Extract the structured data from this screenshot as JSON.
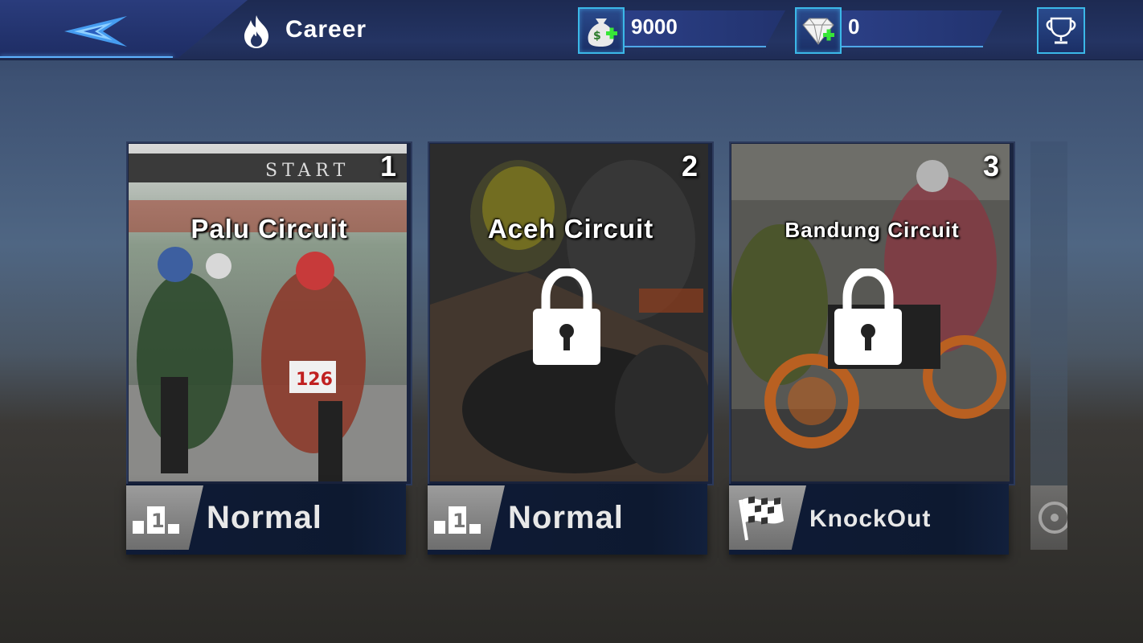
{
  "header": {
    "title": "Career",
    "money": "9000",
    "gems": "0"
  },
  "icons": {
    "back": "back-arrow-icon",
    "title": "flame-icon",
    "money": "money-bag-icon",
    "gems": "diamond-icon",
    "trophy": "trophy-icon"
  },
  "colors": {
    "accent": "#3bb8e8",
    "topbar": "#243463",
    "mode_bar": "#0f1b36"
  },
  "circuits": [
    {
      "number": "1",
      "name": "Palu Circuit",
      "mode": "Normal",
      "locked": false,
      "mode_icon": "podium-icon"
    },
    {
      "number": "2",
      "name": "Aceh Circuit",
      "mode": "Normal",
      "locked": true,
      "mode_icon": "podium-icon"
    },
    {
      "number": "3",
      "name": "Bandung Circuit",
      "mode": "KnockOut",
      "locked": true,
      "mode_icon": "checkered-flag-icon"
    }
  ]
}
